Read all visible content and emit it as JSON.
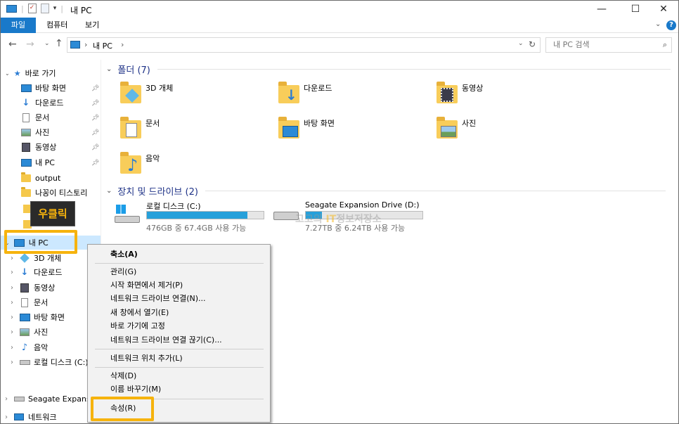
{
  "window": {
    "title": "내 PC",
    "minimize": "—",
    "maximize": "☐",
    "close": "✕"
  },
  "ribbon": {
    "tabs": [
      "파일",
      "컴퓨터",
      "보기"
    ],
    "help": "?"
  },
  "address": {
    "path": "내 PC",
    "sep": "›",
    "search_placeholder": "내 PC 검색"
  },
  "sidebar": {
    "quick_access": "바로 가기",
    "quick_items": [
      {
        "label": "바탕 화면",
        "icon": "desktop-icon"
      },
      {
        "label": "다운로드",
        "icon": "download-icon"
      },
      {
        "label": "문서",
        "icon": "documents-icon"
      },
      {
        "label": "사진",
        "icon": "pictures-icon"
      },
      {
        "label": "동영상",
        "icon": "videos-icon"
      },
      {
        "label": "내 PC",
        "icon": "this-pc-icon"
      },
      {
        "label": "output",
        "icon": "folder-icon"
      },
      {
        "label": "나꽁이 티스토리",
        "icon": "folder-icon"
      }
    ],
    "this_pc": "내 PC",
    "pc_items": [
      {
        "label": "3D 개체",
        "icon": "3d-objects-icon"
      },
      {
        "label": "다운로드",
        "icon": "download-icon"
      },
      {
        "label": "동영상",
        "icon": "videos-icon"
      },
      {
        "label": "문서",
        "icon": "documents-icon"
      },
      {
        "label": "바탕 화면",
        "icon": "desktop-icon"
      },
      {
        "label": "사진",
        "icon": "pictures-icon"
      },
      {
        "label": "음악",
        "icon": "music-icon"
      },
      {
        "label": "로컬 디스크 (C:)",
        "icon": "drive-icon"
      }
    ],
    "seagate": "Seagate Expansio",
    "network": "네트워크"
  },
  "main": {
    "folders_header": "폴더 (7)",
    "folders": [
      {
        "label": "3D 개체",
        "icon": "3d-objects-icon"
      },
      {
        "label": "다운로드",
        "icon": "download-icon"
      },
      {
        "label": "동영상",
        "icon": "videos-icon"
      },
      {
        "label": "문서",
        "icon": "documents-icon"
      },
      {
        "label": "바탕 화면",
        "icon": "desktop-icon"
      },
      {
        "label": "사진",
        "icon": "pictures-icon"
      },
      {
        "label": "음악",
        "icon": "music-icon"
      }
    ],
    "drives_header": "장치 및 드라이브 (2)",
    "drives": [
      {
        "name": "로컬 디스크 (C:)",
        "info": "476GB 중 67.4GB 사용 가능",
        "used_fraction": 0.86
      },
      {
        "name": "Seagate Expansion Drive (D:)",
        "info": "7.27TB 중 6.24TB 사용 가능",
        "used_fraction": 0.14
      }
    ]
  },
  "context_menu": {
    "items": [
      "축소(A)",
      "관리(G)",
      "시작 화면에서 제거(P)",
      "네트워크 드라이브 연결(N)...",
      "새 창에서 열기(E)",
      "바로 가기에 고정",
      "네트워크 드라이브 연결 끊기(C)...",
      "네트워크 위치 추가(L)",
      "삭제(D)",
      "이름 바꾸기(M)",
      "속성(R)"
    ]
  },
  "annotation": {
    "label": "우클릭",
    "watermark_a": "고고의 ",
    "watermark_b": "IT",
    "watermark_c": "정보저장소"
  },
  "colors": {
    "accent": "#1979ca",
    "highlight": "#f6b30d",
    "drive_fill": "#26a0da"
  }
}
